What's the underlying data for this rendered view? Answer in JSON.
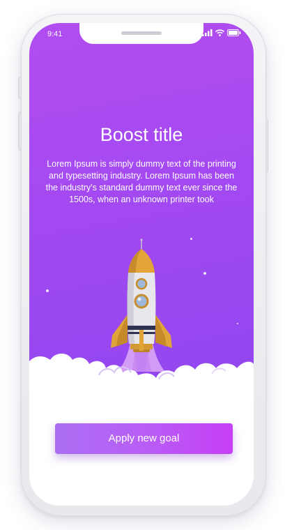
{
  "status_bar": {
    "time": "9:41",
    "icons": [
      "signal-icon",
      "wifi-icon",
      "battery-icon"
    ]
  },
  "boost": {
    "title": "Boost title",
    "body": "Lorem Ipsum is simply dummy text of the printing and typesetting industry. Lorem Ipsum has been the industry's standard dummy text ever since the 1500s, when an unknown printer took"
  },
  "illustration": {
    "icon": "rocket-icon"
  },
  "actions": {
    "apply_label": "Apply new goal"
  },
  "colors": {
    "background_top": "#b24df0",
    "background_bottom": "#9247ef",
    "button_start": "#ab6ff3",
    "button_end": "#c63ff6"
  }
}
